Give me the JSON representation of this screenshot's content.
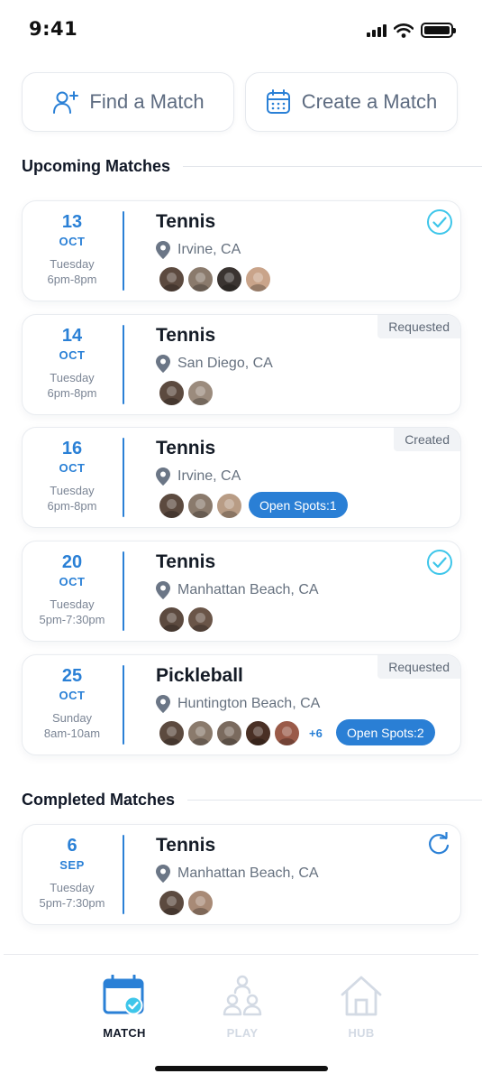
{
  "status_bar": {
    "time": "9:41"
  },
  "actions": {
    "find": {
      "label": "Find a Match",
      "icon": "add-user-icon"
    },
    "create": {
      "label": "Create a Match",
      "icon": "calendar-icon"
    }
  },
  "sections": {
    "upcoming_title": "Upcoming Matches",
    "completed_title": "Completed Matches"
  },
  "upcoming": [
    {
      "day": "13",
      "month": "OCT",
      "weekday": "Tuesday",
      "time": "6pm-8pm",
      "sport": "Tennis",
      "location": "Irvine, CA",
      "status_icon": "check-circle-icon",
      "avatars": [
        "#5c4a3f",
        "#8a7a6c",
        "#3a3431",
        "#c9a48a"
      ]
    },
    {
      "day": "14",
      "month": "OCT",
      "weekday": "Tuesday",
      "time": "6pm-8pm",
      "sport": "Tennis",
      "location": "San Diego, CA",
      "tag": "Requested",
      "avatars": [
        "#5c4a3f",
        "#9b8b7d"
      ]
    },
    {
      "day": "16",
      "month": "OCT",
      "weekday": "Tuesday",
      "time": "6pm-8pm",
      "sport": "Tennis",
      "location": "Irvine, CA",
      "tag": "Created",
      "open_spots": "Open Spots:1",
      "avatars": [
        "#5c4a3f",
        "#8a7a6c",
        "#b89c85"
      ]
    },
    {
      "day": "20",
      "month": "OCT",
      "weekday": "Tuesday",
      "time": "5pm-7:30pm",
      "sport": "Tennis",
      "location": "Manhattan Beach, CA",
      "status_icon": "check-circle-icon",
      "avatars": [
        "#5c4a3f",
        "#6a5548"
      ]
    },
    {
      "day": "25",
      "month": "OCT",
      "weekday": "Sunday",
      "time": "8am-10am",
      "sport": "Pickleball",
      "location": "Huntington Beach, CA",
      "tag": "Requested",
      "open_spots": "Open Spots:2",
      "more": "+6",
      "avatars": [
        "#5c4a3f",
        "#8a7a6c",
        "#7a6a5e",
        "#4a3025",
        "#9a5a48"
      ]
    }
  ],
  "completed": [
    {
      "day": "6",
      "month": "SEP",
      "weekday": "Tuesday",
      "time": "5pm-7:30pm",
      "sport": "Tennis",
      "location": "Manhattan Beach, CA",
      "status_icon": "refresh-icon",
      "avatars": [
        "#5c4a3f",
        "#a88a76"
      ]
    }
  ],
  "nav": {
    "match": {
      "label": "MATCH",
      "active": true
    },
    "play": {
      "label": "PLAY",
      "active": false
    },
    "hub": {
      "label": "HUB",
      "active": false
    }
  },
  "colors": {
    "accent": "#2a80d6",
    "check": "#3ec6ea",
    "nav_inactive": "#d3dae4",
    "text_dark": "#141b26",
    "text_muted": "#66717f"
  }
}
